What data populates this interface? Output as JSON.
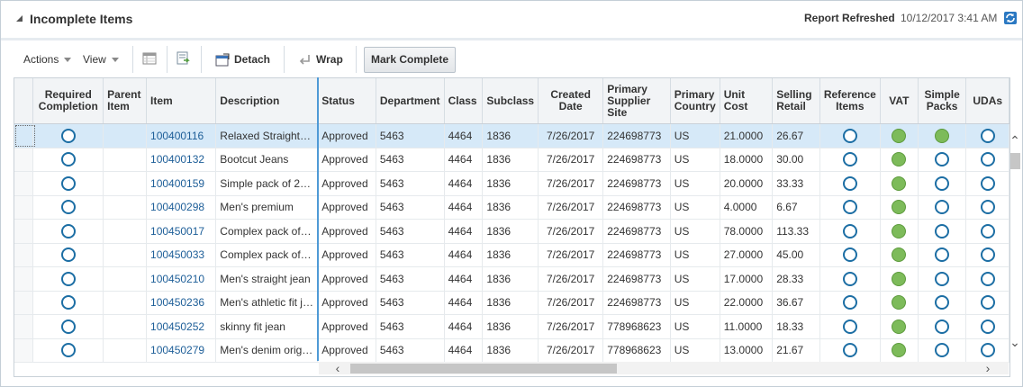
{
  "header": {
    "title": "Incomplete Items",
    "report_refreshed_label": "Report Refreshed",
    "report_refreshed_value": "10/12/2017 3:41 AM"
  },
  "toolbar": {
    "actions_label": "Actions",
    "view_label": "View",
    "detach_label": "Detach",
    "wrap_label": "Wrap",
    "mark_complete_label": "Mark Complete"
  },
  "table": {
    "columns": {
      "required_completion": "Required Completion",
      "parent_item": "Parent Item",
      "item": "Item",
      "description": "Description",
      "status": "Status",
      "department": "Department",
      "class": "Class",
      "subclass": "Subclass",
      "created_date": "Created Date",
      "primary_supplier_site": "Primary Supplier Site",
      "primary_country": "Primary Country",
      "unit_cost": "Unit Cost",
      "selling_retail": "Selling Retail",
      "reference_items": "Reference Items",
      "vat": "VAT",
      "simple_packs": "Simple Packs",
      "udas": "UDAs"
    },
    "rows": [
      {
        "item": "100400116",
        "description": "Relaxed Straight…",
        "status": "Approved",
        "department": "5463",
        "class": "4464",
        "subclass": "1836",
        "created": "7/26/2017",
        "supplier": "224698773",
        "country": "US",
        "unit_cost": "21.0000",
        "retail": "26.67",
        "simple_packs": true
      },
      {
        "item": "100400132",
        "description": "Bootcut Jeans",
        "status": "Approved",
        "department": "5463",
        "class": "4464",
        "subclass": "1836",
        "created": "7/26/2017",
        "supplier": "224698773",
        "country": "US",
        "unit_cost": "18.0000",
        "retail": "30.00",
        "simple_packs": false
      },
      {
        "item": "100400159",
        "description": "Simple pack of 2…",
        "status": "Approved",
        "department": "5463",
        "class": "4464",
        "subclass": "1836",
        "created": "7/26/2017",
        "supplier": "224698773",
        "country": "US",
        "unit_cost": "20.0000",
        "retail": "33.33",
        "simple_packs": false
      },
      {
        "item": "100400298",
        "description": "Men's premium",
        "status": "Approved",
        "department": "5463",
        "class": "4464",
        "subclass": "1836",
        "created": "7/26/2017",
        "supplier": "224698773",
        "country": "US",
        "unit_cost": "4.0000",
        "retail": "6.67",
        "simple_packs": false
      },
      {
        "item": "100450017",
        "description": "Complex pack of…",
        "status": "Approved",
        "department": "5463",
        "class": "4464",
        "subclass": "1836",
        "created": "7/26/2017",
        "supplier": "224698773",
        "country": "US",
        "unit_cost": "78.0000",
        "retail": "113.33",
        "simple_packs": false
      },
      {
        "item": "100450033",
        "description": "Complex pack of…",
        "status": "Approved",
        "department": "5463",
        "class": "4464",
        "subclass": "1836",
        "created": "7/26/2017",
        "supplier": "224698773",
        "country": "US",
        "unit_cost": "27.0000",
        "retail": "45.00",
        "simple_packs": false
      },
      {
        "item": "100450210",
        "description": "Men's straight jean",
        "status": "Approved",
        "department": "5463",
        "class": "4464",
        "subclass": "1836",
        "created": "7/26/2017",
        "supplier": "224698773",
        "country": "US",
        "unit_cost": "17.0000",
        "retail": "28.33",
        "simple_packs": false
      },
      {
        "item": "100450236",
        "description": "Men's athletic fit j…",
        "status": "Approved",
        "department": "5463",
        "class": "4464",
        "subclass": "1836",
        "created": "7/26/2017",
        "supplier": "224698773",
        "country": "US",
        "unit_cost": "22.0000",
        "retail": "36.67",
        "simple_packs": false
      },
      {
        "item": "100450252",
        "description": "skinny fit jean",
        "status": "Approved",
        "department": "5463",
        "class": "4464",
        "subclass": "1836",
        "created": "7/26/2017",
        "supplier": "778968623",
        "country": "US",
        "unit_cost": "11.0000",
        "retail": "18.33",
        "simple_packs": false
      },
      {
        "item": "100450279",
        "description": "Men's denim orig…",
        "status": "Approved",
        "department": "5463",
        "class": "4464",
        "subclass": "1836",
        "created": "7/26/2017",
        "supplier": "778968623",
        "country": "US",
        "unit_cost": "13.0000",
        "retail": "21.67",
        "simple_packs": false
      }
    ]
  },
  "colors": {
    "link": "#1d5e98",
    "selected_row": "#d6e9f8",
    "complete_dot": "#7dbb5a",
    "incomplete_ring": "#1c6ea4",
    "frozen_divider": "#4f9ad6"
  },
  "icons": {
    "collapse": "collapse-triangle-icon",
    "refresh": "refresh-icon",
    "freeze": "freeze-icon",
    "export": "export-icon",
    "detach": "detach-icon",
    "wrap": "wrap-icon"
  }
}
